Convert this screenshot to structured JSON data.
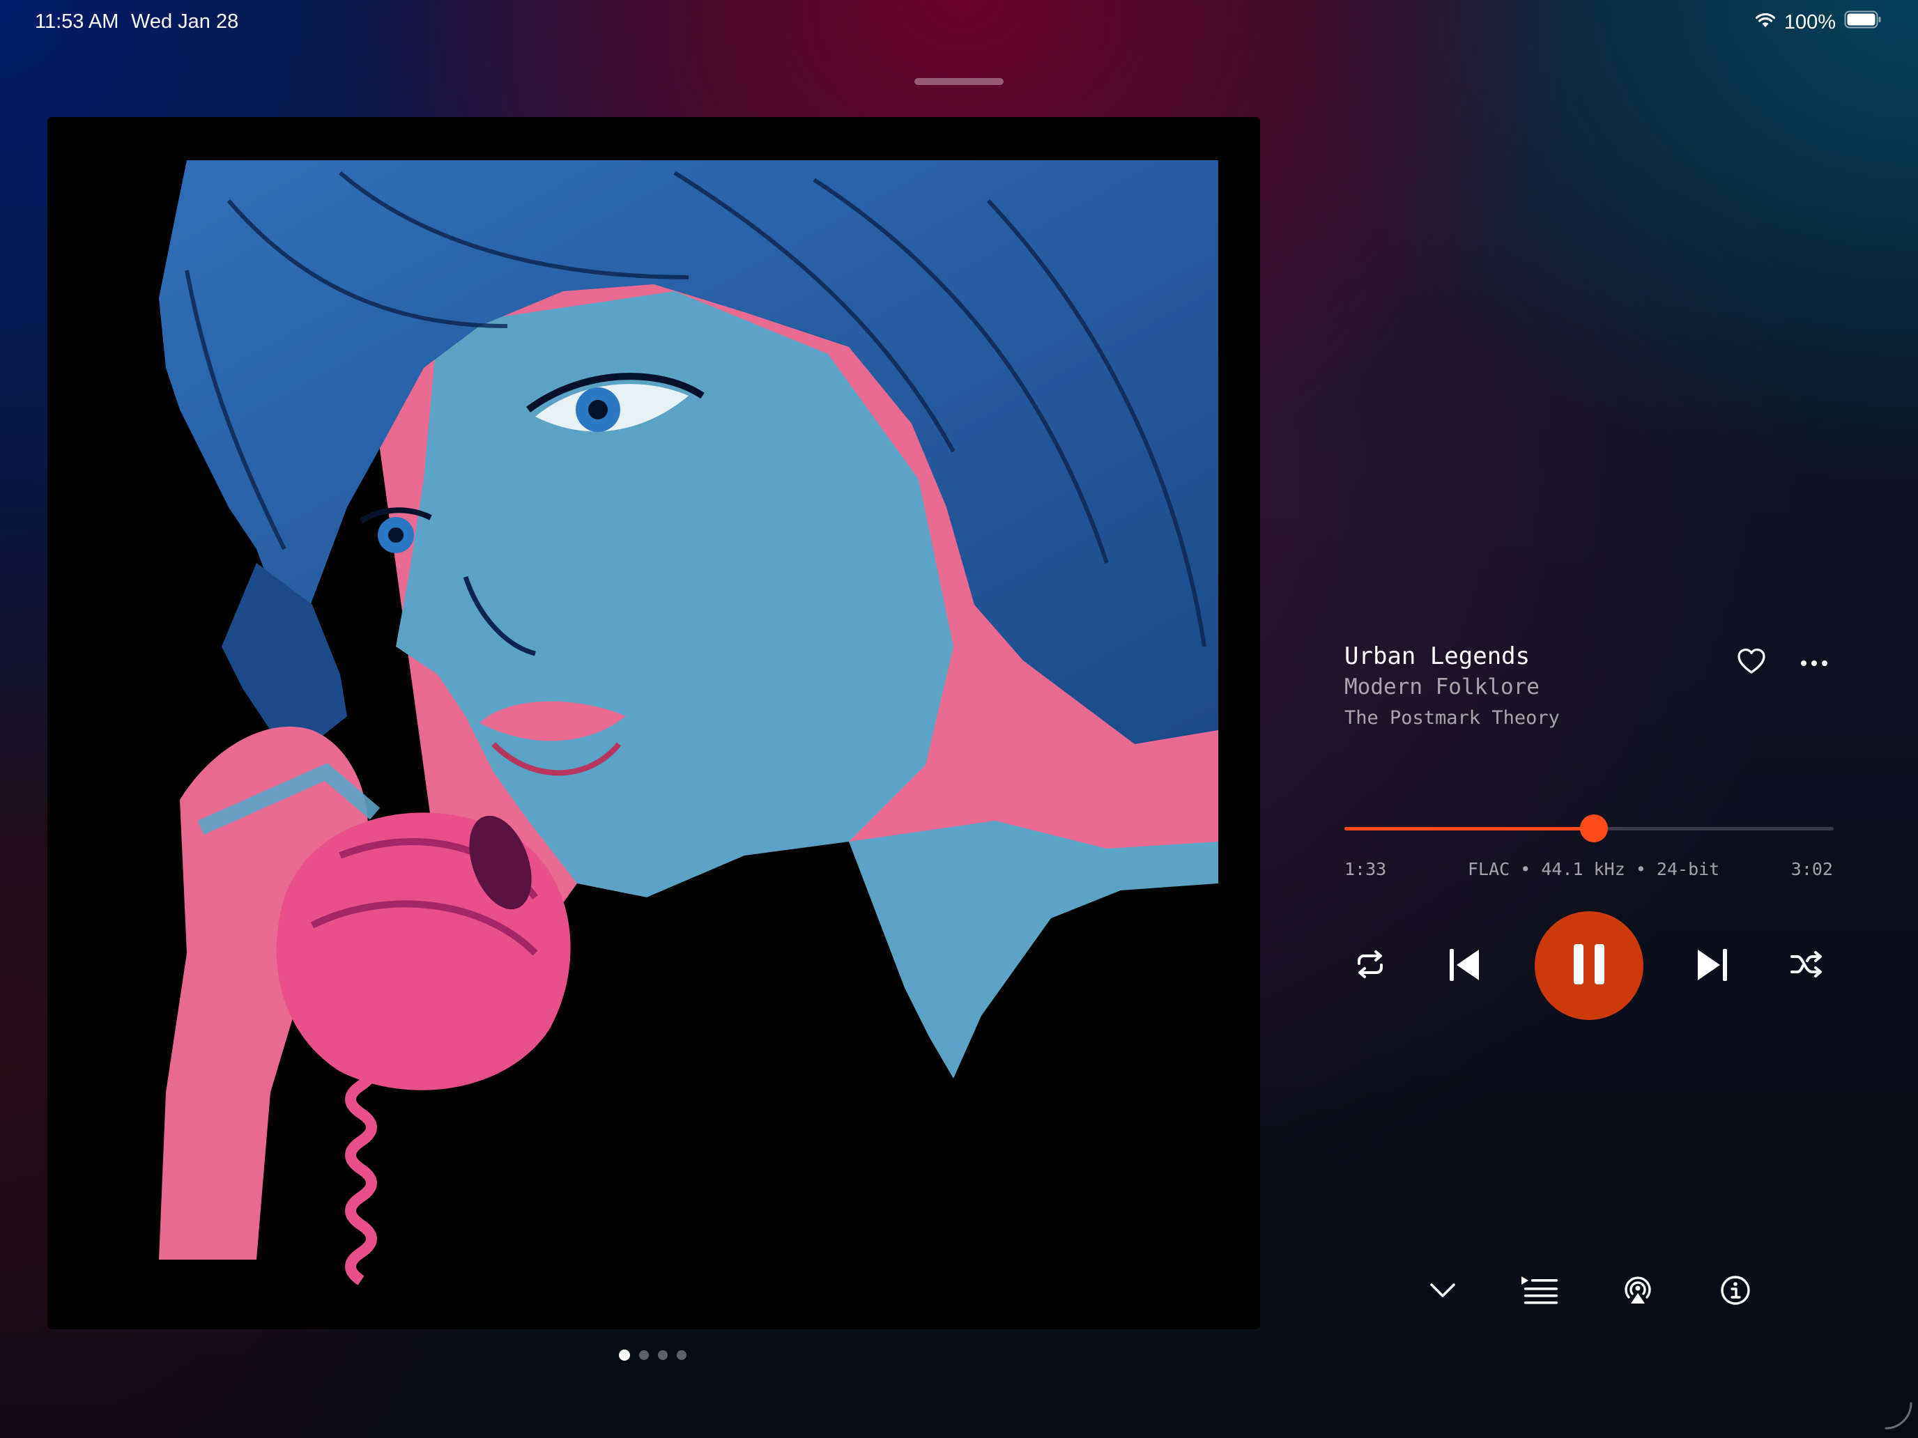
{
  "status_bar": {
    "time": "11:53 AM",
    "date": "Wed Jan 28",
    "battery": "100%",
    "icons": [
      "wifi-icon",
      "battery-icon"
    ]
  },
  "artwork": {
    "page_count": 4,
    "active_page": 1
  },
  "track": {
    "title": "Urban Legends",
    "album": "Modern Folklore",
    "artist": "The Postmark Theory"
  },
  "playback": {
    "elapsed": "1:33",
    "duration": "3:02",
    "format": "FLAC • 44.1 kHz • 24-bit",
    "progress_fraction": 0.51,
    "state": "playing"
  },
  "controls": [
    "repeat-icon",
    "previous-icon",
    "pause-icon",
    "next-icon",
    "shuffle-icon"
  ],
  "bottom_bar": [
    "chevron-down-icon",
    "queue-icon",
    "airplay-icon",
    "info-icon"
  ],
  "colors": {
    "accent": "#ff4a1c",
    "play_button": "#cc3a0c"
  }
}
